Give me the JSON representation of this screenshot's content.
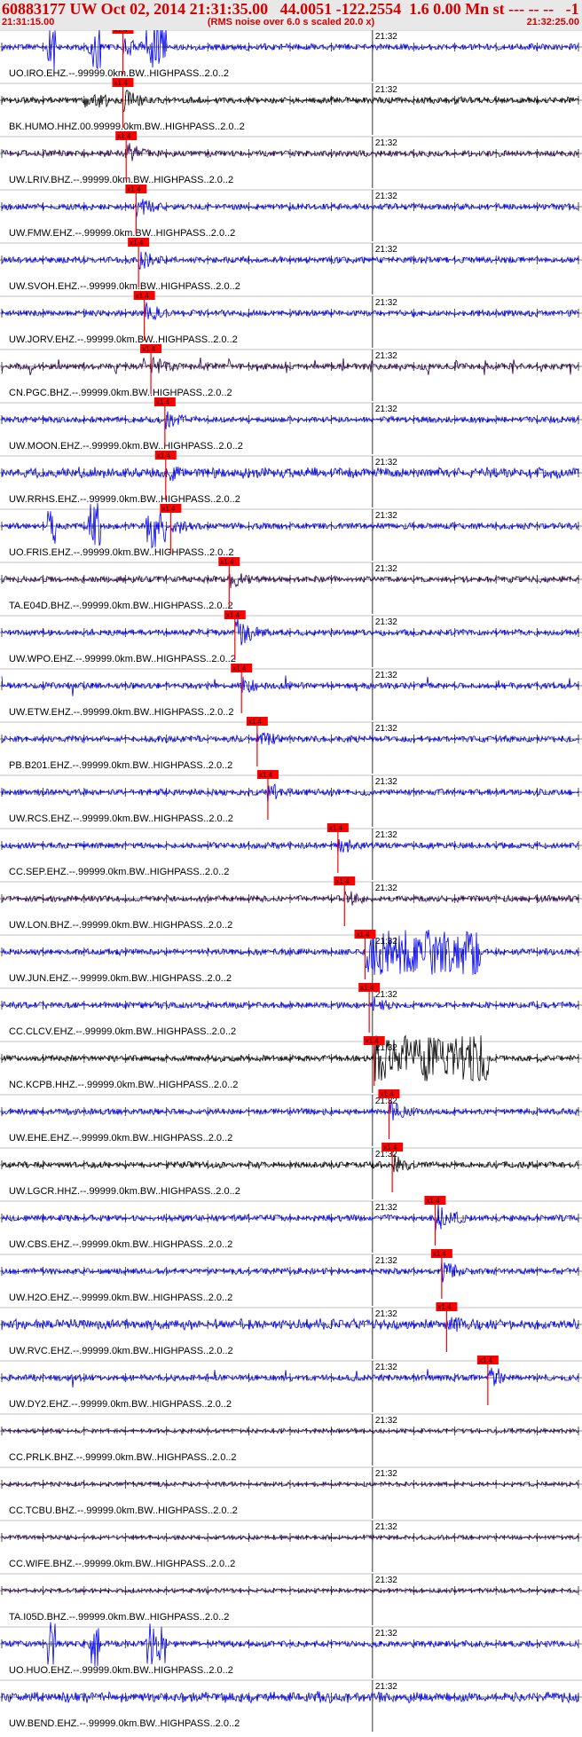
{
  "header": {
    "title": "60883177 UW Oct 02, 2014 21:31:35.00   44.0051 -122.2554  1.6 0.00 Mn st --- -- --   -1",
    "start_time": "21:31:15.00",
    "note": "(RMS noise over 6.0 s scaled 20.0 x)",
    "end_time": "21:32:25.00"
  },
  "chart_data": {
    "type": "seismogram",
    "time_range": [
      "21:31:15.00",
      "21:32:25.00"
    ],
    "minute_marker_label": "21:32",
    "pick_label": "x1.4",
    "colors": {
      "blue": "#0000ee",
      "black": "#000000",
      "purple": "#2a0050",
      "red": "#ff0000",
      "grid": "#000000"
    },
    "stations": [
      {
        "label": "UO.IRO.EHZ.--.99999.0km.BW..HIGHPASS..2.0..2",
        "color": "blue",
        "style": "bursts",
        "pick_s": 14.7
      },
      {
        "label": "BK.HUMO.HHZ.00.99999.0km.BW..HIGHPASS..2.0..2",
        "color": "black",
        "style": "spikes",
        "pick_s": 14.7
      },
      {
        "label": "UW.LRIV.BHZ.--.99999.0km.BW..HIGHPASS..2.0..2",
        "color": "purple",
        "style": "event",
        "pick_s": 15.1
      },
      {
        "label": "UW.FMW.EHZ.--.99999.0km.BW..HIGHPASS..2.0..2",
        "color": "blue",
        "style": "event",
        "pick_s": 16.3
      },
      {
        "label": "UW.SVOH.EHZ.--.99999.0km.BW..HIGHPASS..2.0..2",
        "color": "blue",
        "style": "event",
        "pick_s": 16.6
      },
      {
        "label": "UW.JORV.EHZ.--.99999.0km.BW..HIGHPASS..2.0..2",
        "color": "blue",
        "style": "event",
        "pick_s": 17.3
      },
      {
        "label": "CN.PGC.BHZ.--.99999.0km.BW..HIGHPASS..2.0..2",
        "color": "purple",
        "style": "periodic",
        "pick_s": 18.1
      },
      {
        "label": "UW.MOON.EHZ.--.99999.0km.BW..HIGHPASS..2.0..2",
        "color": "blue",
        "style": "event",
        "pick_s": 19.8
      },
      {
        "label": "UW.RRHS.EHZ.--.99999.0km.BW..HIGHPASS..2.0..2",
        "color": "blue",
        "style": "noisy",
        "pick_s": 19.9
      },
      {
        "label": "UO.FRIS.EHZ.--.99999.0km.BW..HIGHPASS..2.0..2",
        "color": "blue",
        "style": "bursts",
        "pick_s": 20.5
      },
      {
        "label": "TA.E04D.BHZ.--.99999.0km.BW..HIGHPASS..2.0..2",
        "color": "purple",
        "style": "event",
        "pick_s": 27.6
      },
      {
        "label": "UW.WPO.EHZ.--.99999.0km.BW..HIGHPASS..2.0..2",
        "color": "blue",
        "style": "big",
        "pick_s": 28.3
      },
      {
        "label": "UW.ETW.EHZ.--.99999.0km.BW..HIGHPASS..2.0..2",
        "color": "blue",
        "style": "sparse",
        "pick_s": 29.1
      },
      {
        "label": "PB.B201.EHZ.--.99999.0km.BW..HIGHPASS..2.0..2",
        "color": "blue",
        "style": "event",
        "pick_s": 31.0
      },
      {
        "label": "UW.RCS.EHZ.--.99999.0km.BW..HIGHPASS..2.0..2",
        "color": "blue",
        "style": "event",
        "pick_s": 32.3
      },
      {
        "label": "CC.SEP.EHZ.--.99999.0km.BW..HIGHPASS..2.0..2",
        "color": "blue",
        "style": "event",
        "pick_s": 40.8
      },
      {
        "label": "UW.LON.BHZ.--.99999.0km.BW..HIGHPASS..2.0..2",
        "color": "purple",
        "style": "event",
        "pick_s": 41.6
      },
      {
        "label": "UW.JUN.EHZ.--.99999.0km.BW..HIGHPASS..2.0..2",
        "color": "blue",
        "style": "clipped",
        "pick_s": 44.1
      },
      {
        "label": "CC.CLCV.EHZ.--.99999.0km.BW..HIGHPASS..2.0..2",
        "color": "blue",
        "style": "event",
        "pick_s": 44.6
      },
      {
        "label": "NC.KCPB.HHZ.--.99999.0km.BW..HIGHPASS..2.0..2",
        "color": "black",
        "style": "clipped",
        "pick_s": 45.2
      },
      {
        "label": "UW.EHE.EHZ.--.99999.0km.BW..HIGHPASS..2.0..2",
        "color": "blue",
        "style": "event",
        "pick_s": 47.0
      },
      {
        "label": "UW.LGCR.HHZ.--.99999.0km.BW..HIGHPASS..2.0..2",
        "color": "black",
        "style": "event",
        "pick_s": 47.4
      },
      {
        "label": "UW.CBS.EHZ.--.99999.0km.BW..HIGHPASS..2.0..2",
        "color": "blue",
        "style": "big",
        "pick_s": 52.6
      },
      {
        "label": "UW.H2O.EHZ.--.99999.0km.BW..HIGHPASS..2.0..2",
        "color": "blue",
        "style": "event",
        "pick_s": 53.4
      },
      {
        "label": "UW.RVC.EHZ.--.99999.0km.BW..HIGHPASS..2.0..2",
        "color": "blue",
        "style": "noisy",
        "pick_s": 54.0
      },
      {
        "label": "UW.DY2.EHZ.--.99999.0km.BW..HIGHPASS..2.0..2",
        "color": "blue",
        "style": "sparse",
        "pick_s": 59.0
      },
      {
        "label": "CC.PRLK.BHZ.--.99999.0km.BW..HIGHPASS..2.0..2",
        "color": "purple",
        "style": "quiet",
        "pick_s": null
      },
      {
        "label": "CC.TCBU.BHZ.--.99999.0km.BW..HIGHPASS..2.0..2",
        "color": "purple",
        "style": "quiet",
        "pick_s": null
      },
      {
        "label": "CC.WIFE.BHZ.--.99999.0km.BW..HIGHPASS..2.0..2",
        "color": "purple",
        "style": "quiet",
        "pick_s": null
      },
      {
        "label": "TA.I05D.BHZ.--.99999.0km.BW..HIGHPASS..2.0..2",
        "color": "purple",
        "style": "quiet",
        "pick_s": null
      },
      {
        "label": "UO.HUO.EHZ.--.99999.0km.BW..HIGHPASS..2.0..2",
        "color": "blue",
        "style": "bursts",
        "pick_s": null
      },
      {
        "label": "UW.BEND.EHZ.--.99999.0km.BW..HIGHPASS..2.0..2",
        "color": "blue",
        "style": "noisy",
        "pick_s": null
      }
    ]
  }
}
